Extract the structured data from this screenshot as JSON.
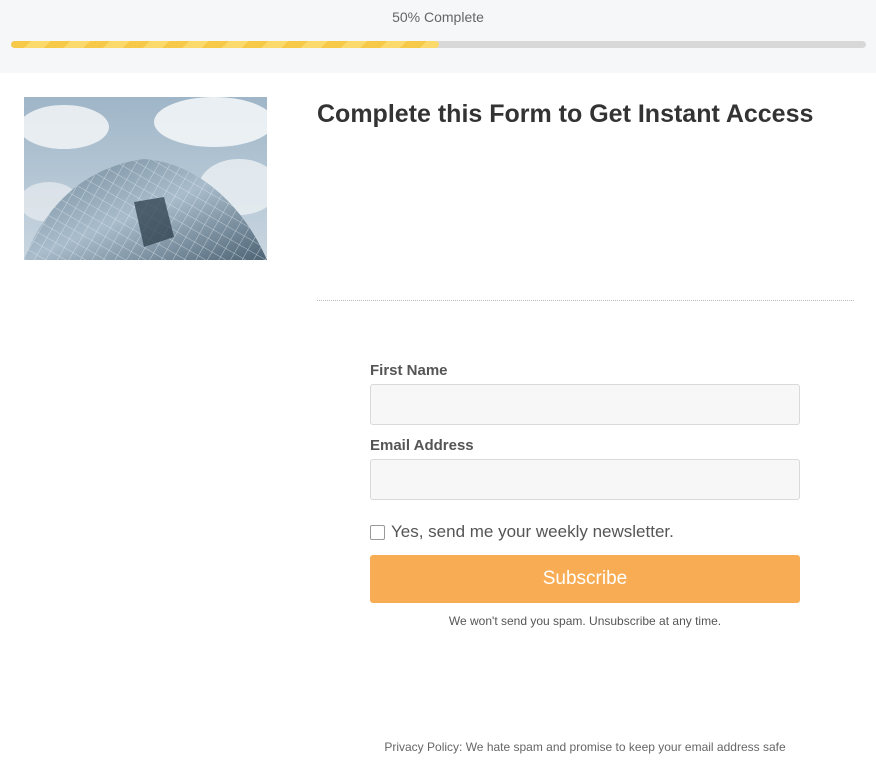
{
  "progress": {
    "label": "50% Complete",
    "fraction": 0.5
  },
  "hero": {
    "icon": "building-photo"
  },
  "form": {
    "title": "Complete this Form to Get Instant Access",
    "first_name_label": "First Name",
    "first_name_value": "",
    "email_label": "Email Address",
    "email_value": "",
    "newsletter_label": "Yes, send me your weekly newsletter.",
    "newsletter_checked": false,
    "subscribe_label": "Subscribe",
    "spam_note": "We won't send you spam. Unsubscribe at any time."
  },
  "footer": {
    "privacy": "Privacy Policy: We hate spam and promise to keep your email address safe"
  },
  "colors": {
    "accent": "#f8ad55",
    "progress": "#f7c948",
    "track": "#d8d8d8"
  }
}
